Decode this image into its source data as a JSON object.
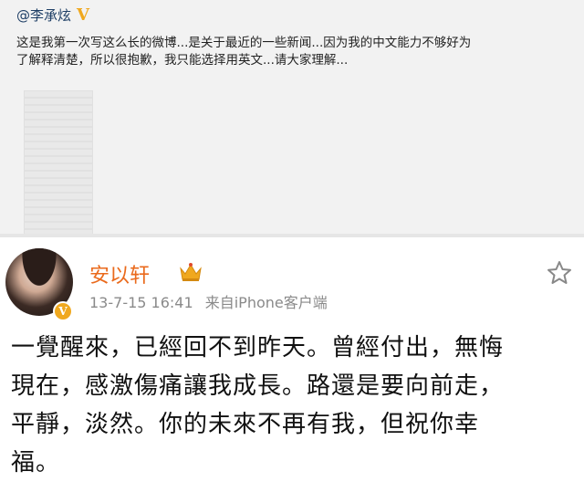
{
  "post_top": {
    "author": "@李承炫",
    "verified_badge": "V",
    "lines": [
      "这是我第一次写这么长的微博...是关于最近的一些新闻...因为我的中文能力不够好为",
      "了解释清楚，所以很抱歉，我只能选择用英文...请大家理解..."
    ]
  },
  "post_bottom": {
    "author": "安以轩",
    "verified_badge": "V",
    "timestamp": "13-7-15 16:41",
    "source": "来自iPhone客户端",
    "lines": [
      "一覺醒來，已經回不到昨天。曾經付出，無悔",
      "現在，感激傷痛讓我成長。路還是要向前走，",
      "平靜，淡然。你的未來不再有我，但祝你幸",
      "福。"
    ]
  },
  "icons": {
    "crown": "crown-icon",
    "favorite": "star-icon"
  },
  "colors": {
    "accent_orange": "#ea6a1c",
    "verified_gold": "#f0a81e",
    "link_blue": "#1f3f66"
  }
}
